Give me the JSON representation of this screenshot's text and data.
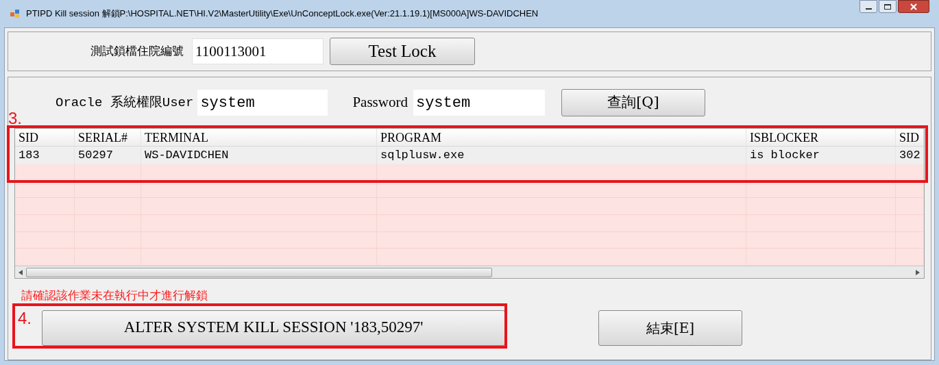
{
  "window": {
    "title": "PTIPD Kill session 解鎖P:\\HOSPITAL.NET\\HI.V2\\MasterUtility\\Exe\\UnConceptLock.exe(Ver:21.1.19.1)[MS000A]WS-DAVIDCHEN"
  },
  "test_lock": {
    "label": "測試鎖檔住院編號",
    "value": "1100113001",
    "button": "Test Lock"
  },
  "login": {
    "user_label": "Oracle 系統權限User",
    "user_value": "system",
    "password_label": "Password",
    "password_value": "system",
    "button": "查詢[Q]"
  },
  "table": {
    "columns": [
      "SID",
      "SERIAL#",
      "TERMINAL",
      "PROGRAM",
      "ISBLOCKER",
      "SID"
    ],
    "rows": [
      [
        "183",
        "50297",
        "WS-DAVIDCHEN",
        "sqlplusw.exe",
        "is blocker",
        "302"
      ]
    ]
  },
  "warning": "請確認該作業未在執行中才進行解鎖",
  "kill_button": "ALTER SYSTEM KILL SESSION '183,50297'",
  "exit_button": "結束[E]",
  "annotations": [
    {
      "label": "3."
    },
    {
      "label": "4."
    }
  ]
}
